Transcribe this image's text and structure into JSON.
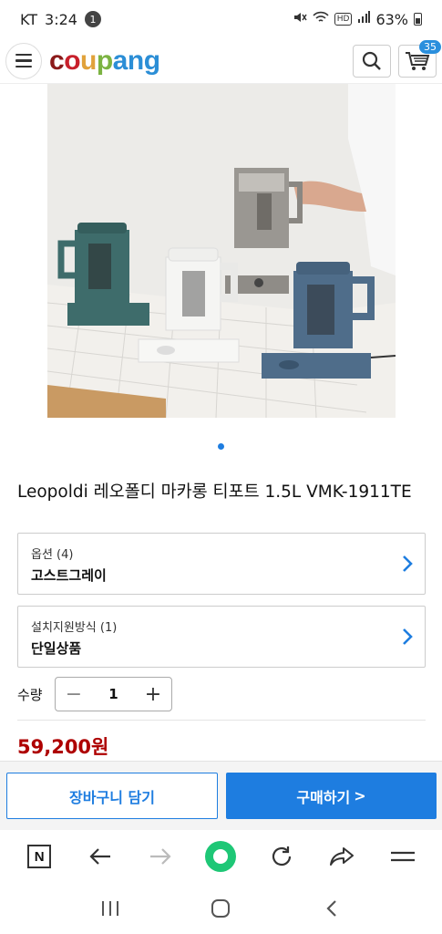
{
  "status_bar": {
    "carrier": "KT",
    "time": "3:24",
    "notification_count": "1",
    "battery": "63%",
    "hd_label": "HD"
  },
  "header": {
    "logo_letters": [
      "c",
      "o",
      "u",
      "p",
      "a",
      "n",
      "g"
    ],
    "logo_colors": [
      "#8b1a1a",
      "#c8202b",
      "#e1a23b",
      "#7cb342",
      "#2b8ed6",
      "#2b8ed6",
      "#2b8ed6"
    ],
    "cart_count": "35",
    "icons": [
      "menu-icon",
      "search-icon",
      "cart-icon"
    ]
  },
  "product": {
    "image_dot_count": 1,
    "title": "Leopoldi 레오폴디 마카롱 티포트 1.5L VMK-1911TE",
    "options": [
      {
        "label": "옵션 (4)",
        "value": "고스트그레이"
      },
      {
        "label": "설치지원방식 (1)",
        "value": "단일상품"
      }
    ],
    "quantity_label": "수량",
    "quantity_value": "1",
    "price": "59,200원"
  },
  "actions": {
    "add_to_cart": "장바구니 담기",
    "buy_now": "구매하기",
    "buy_now_arrow": ">"
  },
  "browser_nav": {
    "tab_letter": "N",
    "icons": [
      "tabs-icon",
      "back-arrow-icon",
      "forward-arrow-icon",
      "home-circle-icon",
      "reload-icon",
      "share-icon",
      "menu-icon"
    ]
  },
  "system_nav": {
    "icons": [
      "recent-apps-icon",
      "home-icon",
      "back-icon"
    ]
  },
  "colors": {
    "accent_blue": "#1e7de0",
    "price_red": "#ae0000",
    "browser_green": "#1ec776"
  }
}
